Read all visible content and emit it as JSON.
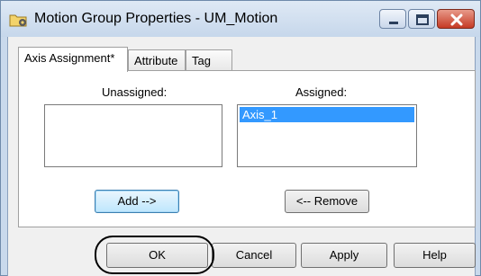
{
  "window": {
    "title": "Motion Group Properties - UM_Motion",
    "icons": {
      "app": "folder-gear-icon",
      "minimize": "minimize-icon",
      "maximize": "maximize-icon",
      "close": "close-icon"
    }
  },
  "tabs": [
    {
      "label": "Axis Assignment*",
      "active": true
    },
    {
      "label": "Attribute",
      "active": false
    },
    {
      "label": "Tag",
      "active": false
    }
  ],
  "panel": {
    "unassigned_label": "Unassigned:",
    "assigned_label": "Assigned:",
    "unassigned_items": [],
    "assigned_items": [
      "Axis_1"
    ],
    "add_label": "Add -->",
    "remove_label": "<-- Remove"
  },
  "footer": {
    "ok_label": "OK",
    "cancel_label": "Cancel",
    "apply_label": "Apply",
    "help_label": "Help"
  },
  "colors": {
    "selection": "#3399ff",
    "frame": "#c9d9ec",
    "close_button": "#c53a24"
  }
}
